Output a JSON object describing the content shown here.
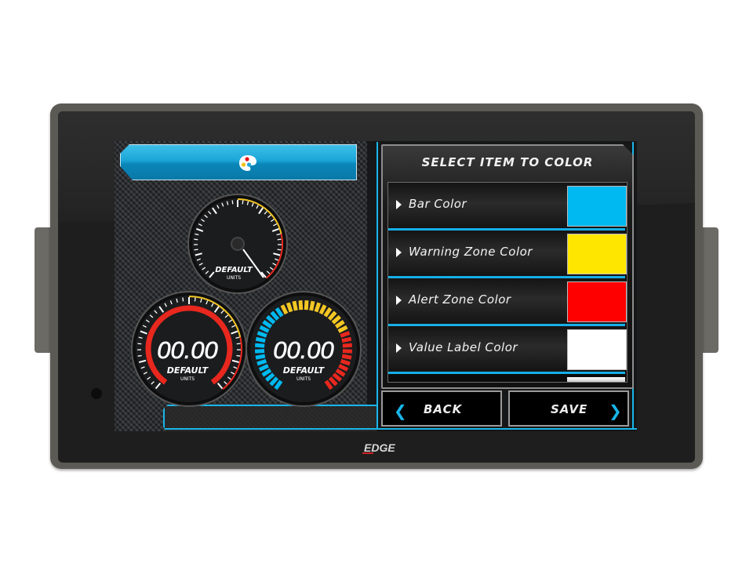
{
  "device": {
    "brand_logo": "EDGE",
    "camera_icon": "camera-lens-icon"
  },
  "header": {
    "icon": "color-palette-icon",
    "palette_dot_colors": [
      "#e3101a",
      "#f2c214",
      "#1fa6e0"
    ]
  },
  "gauges": [
    {
      "name": "top-gauge",
      "type": "needle",
      "label": "DEFAULT",
      "units": "UNITS",
      "value": null
    },
    {
      "name": "left-gauge",
      "type": "arc",
      "value_text": "00.00",
      "label": "DEFAULT",
      "units": "UNITS",
      "bar_color": "#e8281e"
    },
    {
      "name": "right-gauge",
      "type": "segmented",
      "value_text": "00.00",
      "label": "DEFAULT",
      "units": "UNITS"
    }
  ],
  "panel": {
    "title": "SELECT ITEM TO COLOR",
    "items": [
      {
        "label": "Bar Color",
        "color": "#00b9f0"
      },
      {
        "label": "Warning Zone Color",
        "color": "#ffe600"
      },
      {
        "label": "Alert Zone Color",
        "color": "#ff0000"
      },
      {
        "label": "Value Label Color",
        "color": "#ffffff"
      }
    ]
  },
  "buttons": {
    "back_label": "BACK",
    "save_label": "SAVE",
    "back_icon": "chevron-left-icon",
    "save_icon": "chevron-right-icon"
  },
  "colors": {
    "accent": "#19b6ea",
    "warning": "#f3c623",
    "alert": "#e8281e"
  }
}
